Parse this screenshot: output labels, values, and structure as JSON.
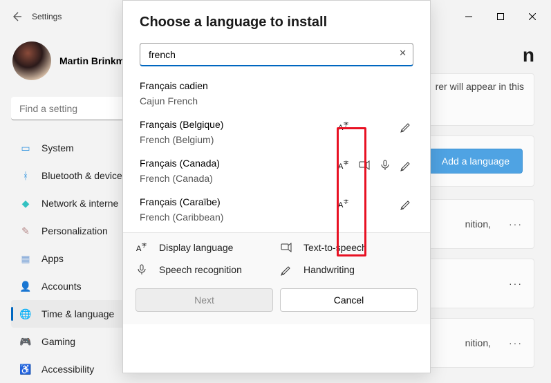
{
  "titlebar": {
    "title": "Settings"
  },
  "profile": {
    "name": "Martin Brinkm"
  },
  "sidebar_search": {
    "placeholder": "Find a setting"
  },
  "nav": {
    "system": "System",
    "bluetooth": "Bluetooth & device",
    "network": "Network & interne",
    "personalization": "Personalization",
    "apps": "Apps",
    "accounts": "Accounts",
    "time": "Time & language",
    "gaming": "Gaming",
    "accessibility": "Accessibility"
  },
  "main": {
    "title_partial": "n",
    "subtitle_partial": "rer will appear in this",
    "add_language": "Add a language",
    "row_tail_text": "nition,",
    "dots": "···"
  },
  "modal": {
    "title": "Choose a language to install",
    "search_value": "french",
    "clear": "✕",
    "legend": {
      "display": "Display language",
      "tts": "Text-to-speech",
      "speech": "Speech recognition",
      "hand": "Handwriting"
    },
    "next": "Next",
    "cancel": "Cancel"
  },
  "languages": [
    {
      "native": "Français cadien",
      "english": "Cajun French",
      "features": []
    },
    {
      "native": "Français (Belgique)",
      "english": "French (Belgium)",
      "features": [
        "display",
        "hand"
      ]
    },
    {
      "native": "Français (Canada)",
      "english": "French (Canada)",
      "features": [
        "display",
        "tts",
        "speech",
        "hand"
      ]
    },
    {
      "native": "Français (Caraïbe)",
      "english": "French (Caribbean)",
      "features": [
        "display",
        "hand"
      ]
    }
  ],
  "icons": {
    "display_svg": "Aᵀ",
    "tts": "🗣",
    "speech": "🎤",
    "hand": "✎"
  }
}
